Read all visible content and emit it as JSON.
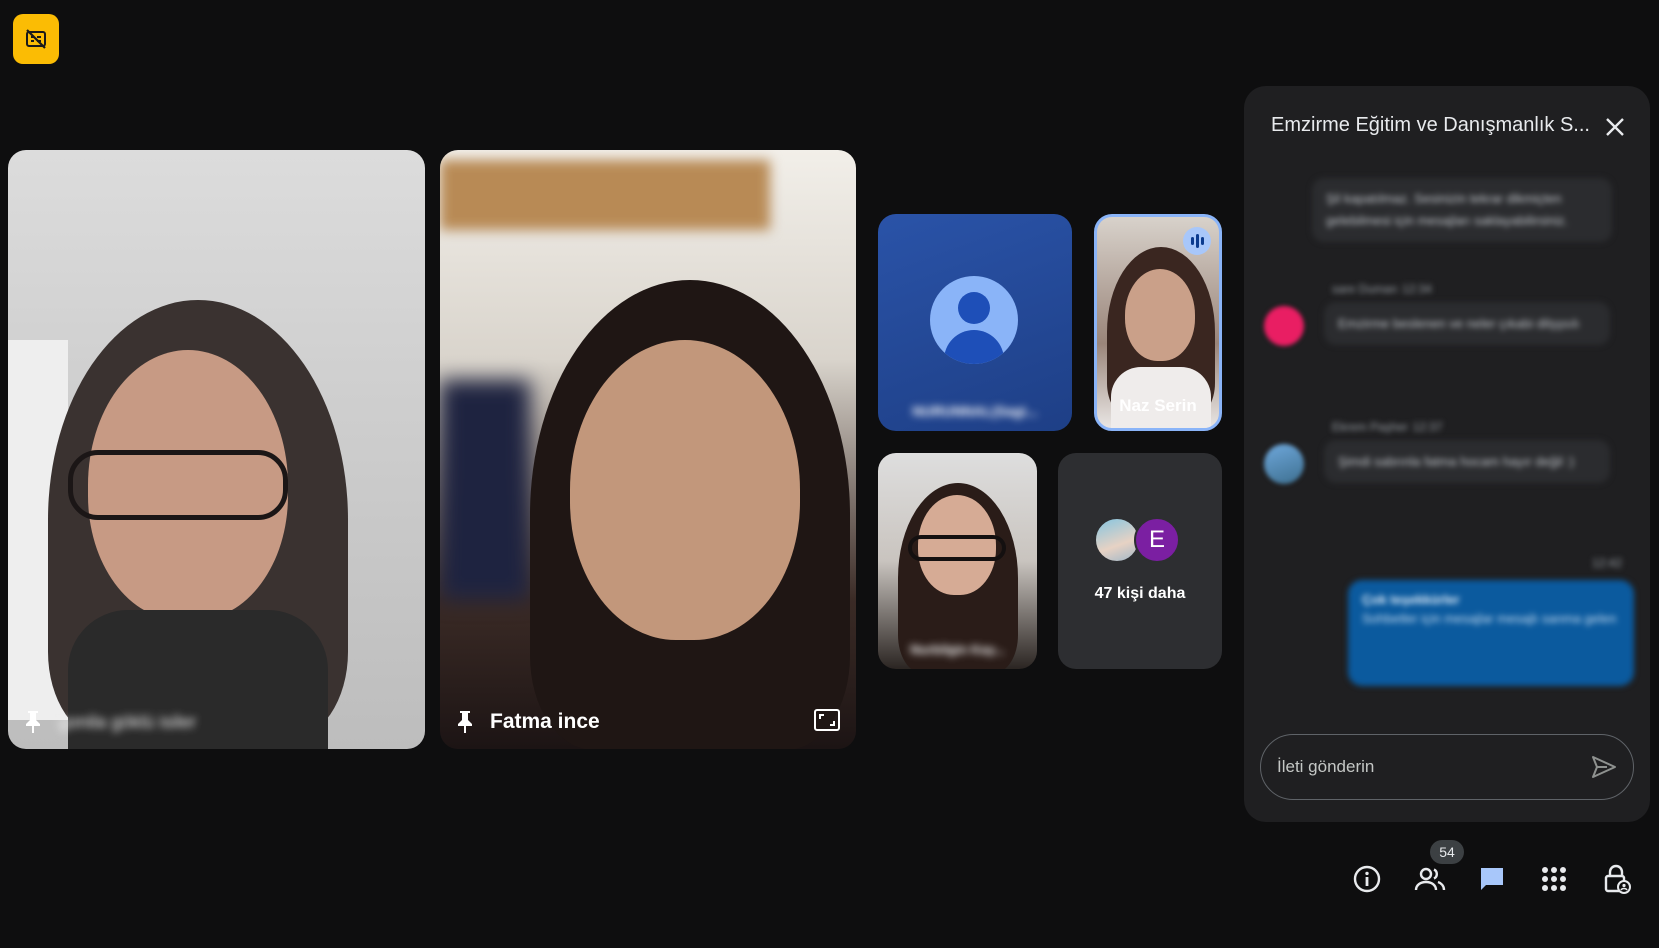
{
  "participants": {
    "tile1_name": "gonila göklü isiler",
    "tile2_name": "Fatma ince",
    "tile3_name": "NURUNNAL(Sagi...",
    "tile4_name": "Naz Serin",
    "tile5_name": "Nurbilgin Kay...",
    "more_letter": "E",
    "more_label": "47 kişi daha"
  },
  "chat": {
    "title": "Emzirme Eğitim ve Danışmanlık S...",
    "system_note": "Şil kapatılmaz. Sesinizin tekrar dikmiçten gelebilmesi için mesajları saklayabilirsiniz.",
    "messages": [
      {
        "sender": "sare Duman",
        "time": "12:34",
        "text": "Emzirme beslenen ve neler çıkabi dilşşsılı"
      },
      {
        "sender": "Ekrem Paşher",
        "time": "12:37",
        "text": "Şimdi sabrınla fatma hocam hayır değil :)"
      }
    ],
    "own_time": "12:42",
    "own_title": "Çok teşekkürler",
    "own_text": "Sohbetler için mesajlar mesajlı sanma gelen",
    "input_placeholder": "İleti gönderin"
  },
  "toolbar": {
    "people_count": "54"
  },
  "colors": {
    "accent": "#8ab4f8",
    "badge": "#fbbc04",
    "panel": "#1f1f21",
    "background": "#0e0e0f"
  }
}
